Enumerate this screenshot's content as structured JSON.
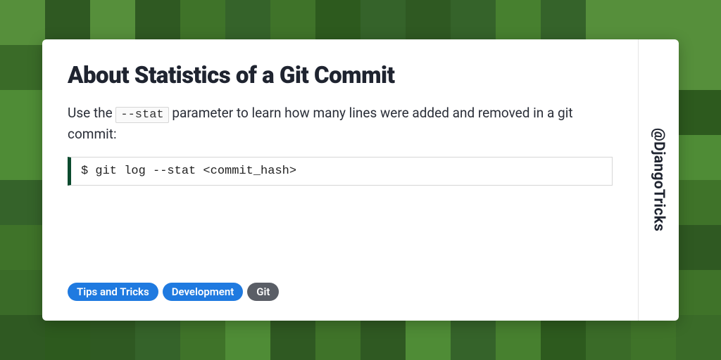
{
  "title": "About Statistics of a Git Commit",
  "description_pre": "Use the ",
  "description_code": "--stat",
  "description_post": " parameter to learn how many lines were added and removed in a git commit:",
  "code_block": "$ git log --stat <commit_hash>",
  "tags": [
    {
      "label": "Tips and Tricks",
      "variant": "blue"
    },
    {
      "label": "Development",
      "variant": "blue"
    },
    {
      "label": "Git",
      "variant": "gray"
    }
  ],
  "handle": "@DjangoTricks",
  "bg_colors": [
    "#2d5a1e",
    "#3a6b28",
    "#47802f",
    "#4f8c36",
    "#3f7329",
    "#35632a",
    "#2f5922",
    "#568f3b"
  ]
}
